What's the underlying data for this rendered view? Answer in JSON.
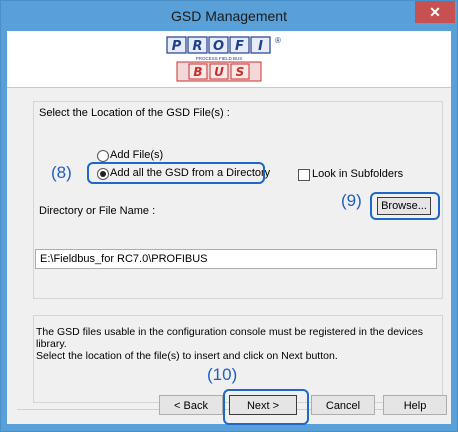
{
  "window": {
    "title": "GSD Management",
    "close_glyph": "✕"
  },
  "logo": {
    "letters_top": [
      "P",
      "R",
      "O",
      "F",
      "I"
    ],
    "letters_bottom": [
      "B",
      "U",
      "S"
    ],
    "tagline": "PROCESS FIELD BUS",
    "mark": "®",
    "colors": {
      "top": "#1f3f8f",
      "bottom": "#c83030"
    }
  },
  "location": {
    "group_label": "Select the Location of the GSD File(s) :",
    "options": [
      {
        "label": "Add File(s)",
        "selected": false
      },
      {
        "label": "Add all the GSD from a Directory",
        "selected": true
      }
    ],
    "subfolders_label": "Look in Subfolders",
    "subfolders_checked": false,
    "path_label": "Directory or File Name :",
    "path_value": "E:\\Fieldbus_for RC7.0\\PROFIBUS",
    "browse_label": "Browse..."
  },
  "info": {
    "line1": "The GSD files usable in the configuration console must be registered in the devices library.",
    "line2": "Select the location of the file(s) to insert and click on Next button."
  },
  "buttons": {
    "back_label": "< Back",
    "next_label": "Next >",
    "cancel_label": "Cancel",
    "help_label": "Help"
  },
  "callouts": {
    "c8": "(8)",
    "c9": "(9)",
    "c10": "(10)",
    "color": "#1f67c8"
  }
}
